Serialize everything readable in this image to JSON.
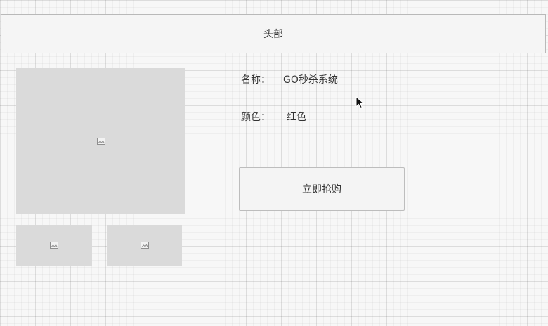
{
  "header": {
    "title": "头部"
  },
  "product": {
    "name_label": "名称：",
    "name_value": "GO秒杀系统",
    "color_label": "颜色：",
    "color_value": "红色"
  },
  "actions": {
    "buy_label": "立即抢购"
  },
  "images": {
    "main_icon": "image-placeholder-icon",
    "thumb_icon": "image-placeholder-icon"
  },
  "colors": {
    "placeholder_fill": "#dadada",
    "header_fill": "#f5f5f5",
    "border": "#b9b9b9"
  }
}
